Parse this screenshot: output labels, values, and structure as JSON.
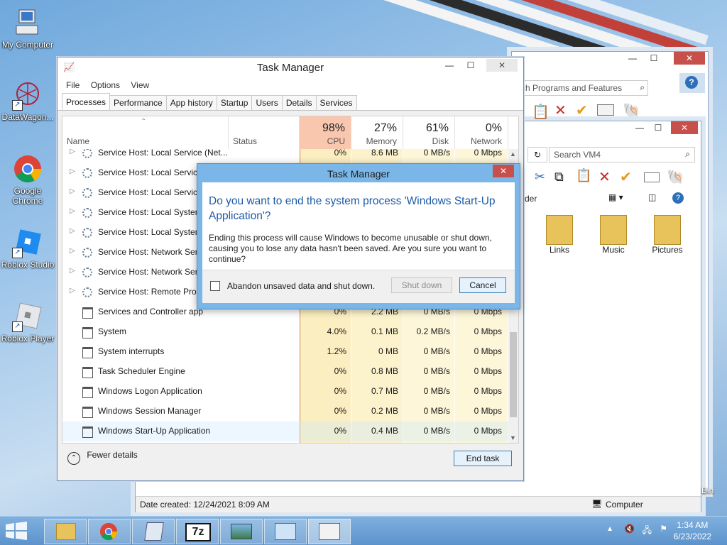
{
  "desktop": {
    "icons": [
      {
        "label": "My Computer"
      },
      {
        "label": "DataWagon..."
      },
      {
        "label": "Google Chrome"
      },
      {
        "label": "Roblox Studio"
      },
      {
        "label": "Roblox Player"
      }
    ],
    "recycle_partial": "Bin"
  },
  "back_window": {
    "search_programs": "ch Programs and Features",
    "search_vm": "Search VM4",
    "header_partial": "der",
    "folders": [
      {
        "label": "Links"
      },
      {
        "label": "Music"
      },
      {
        "label": "Pictures"
      }
    ],
    "status_date": "Date created: 12/24/2021 8:09 AM",
    "status_computer": "Computer"
  },
  "task_manager": {
    "title": "Task Manager",
    "menu": [
      "File",
      "Options",
      "View"
    ],
    "tabs": [
      "Processes",
      "Performance",
      "App history",
      "Startup",
      "Users",
      "Details",
      "Services"
    ],
    "columns": {
      "name": "Name",
      "status": "Status",
      "cpu": {
        "pct": "98%",
        "label": "CPU"
      },
      "memory": {
        "pct": "27%",
        "label": "Memory"
      },
      "disk": {
        "pct": "61%",
        "label": "Disk"
      },
      "network": {
        "pct": "0%",
        "label": "Network"
      }
    },
    "rows": [
      {
        "name": "Service Host: Local Service (Net...",
        "cpu": "0%",
        "mem": "8.6 MB",
        "disk": "0 MB/s",
        "net": "0 Mbps",
        "expand": true
      },
      {
        "name": "Service Host: Local Service",
        "cpu": "",
        "mem": "",
        "disk": "",
        "net": "",
        "expand": true
      },
      {
        "name": "Service Host: Local Service",
        "cpu": "",
        "mem": "",
        "disk": "",
        "net": "",
        "expand": true
      },
      {
        "name": "Service Host: Local System",
        "cpu": "",
        "mem": "",
        "disk": "",
        "net": "",
        "expand": true
      },
      {
        "name": "Service Host: Local System",
        "cpu": "",
        "mem": "",
        "disk": "",
        "net": "",
        "expand": true
      },
      {
        "name": "Service Host: Network Serv",
        "cpu": "",
        "mem": "",
        "disk": "",
        "net": "",
        "expand": true
      },
      {
        "name": "Service Host: Network Serv",
        "cpu": "",
        "mem": "",
        "disk": "",
        "net": "",
        "expand": true
      },
      {
        "name": "Service Host: Remote Proc",
        "cpu": "",
        "mem": "",
        "disk": "",
        "net": "",
        "expand": true
      },
      {
        "name": "Services and Controller app",
        "cpu": "0%",
        "mem": "2.2 MB",
        "disk": "0 MB/s",
        "net": "0 Mbps",
        "expand": false
      },
      {
        "name": "System",
        "cpu": "4.0%",
        "mem": "0.1 MB",
        "disk": "0.2 MB/s",
        "net": "0 Mbps",
        "expand": false
      },
      {
        "name": "System interrupts",
        "cpu": "1.2%",
        "mem": "0 MB",
        "disk": "0 MB/s",
        "net": "0 Mbps",
        "expand": false
      },
      {
        "name": "Task Scheduler Engine",
        "cpu": "0%",
        "mem": "0.8 MB",
        "disk": "0 MB/s",
        "net": "0 Mbps",
        "expand": false
      },
      {
        "name": "Windows Logon Application",
        "cpu": "0%",
        "mem": "0.7 MB",
        "disk": "0 MB/s",
        "net": "0 Mbps",
        "expand": false
      },
      {
        "name": "Windows Session Manager",
        "cpu": "0%",
        "mem": "0.2 MB",
        "disk": "0 MB/s",
        "net": "0 Mbps",
        "expand": false
      },
      {
        "name": "Windows Start-Up Application",
        "cpu": "0%",
        "mem": "0.4 MB",
        "disk": "0 MB/s",
        "net": "0 Mbps",
        "expand": false
      }
    ],
    "fewer_details": "Fewer details",
    "end_task": "End task"
  },
  "dialog": {
    "title": "Task Manager",
    "question": "Do you want to end the system process 'Windows Start-Up Application'?",
    "message": "Ending this process will cause Windows to become unusable or shut down, causing you to lose any data hasn't been saved. Are you sure you want to continue?",
    "checkbox_label": "Abandon unsaved data and shut down.",
    "shutdown_label": "Shut down",
    "cancel_label": "Cancel"
  },
  "taskbar": {
    "time": "1:34 AM",
    "date": "6/23/2022",
    "sevenzip_label": "7z"
  },
  "colors": {
    "dialog_frame": "#7ab7e8",
    "question_text": "#1d5aa6",
    "close_red": "#c7504b",
    "cpu_highlight": "#fbd2c0"
  }
}
